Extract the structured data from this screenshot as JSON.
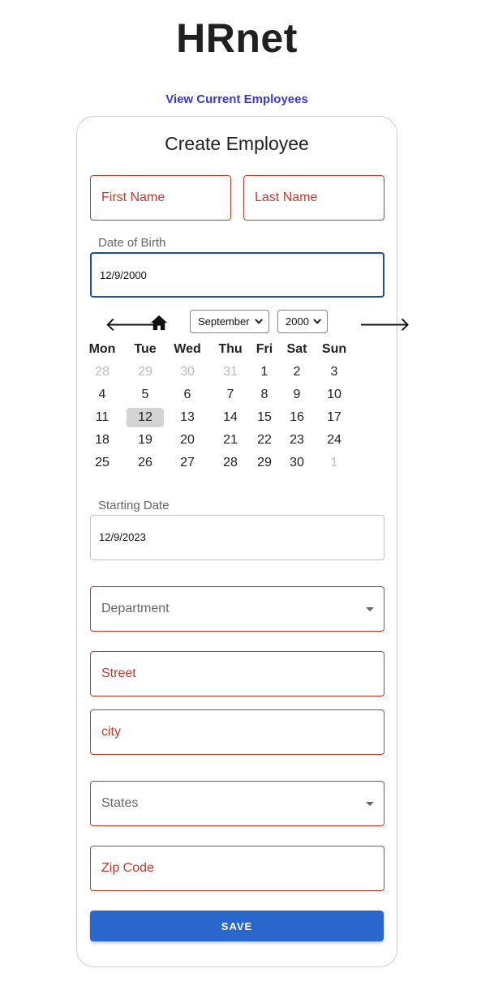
{
  "app": {
    "title": "HRnet"
  },
  "nav": {
    "current_employees_link": "View Current Employees"
  },
  "form": {
    "title": "Create Employee",
    "first_name_placeholder": "First Name",
    "last_name_placeholder": "Last Name",
    "dob_label": "Date of Birth",
    "dob_value": "12/9/2000",
    "start_label": "Starting Date",
    "start_value": "12/9/2023",
    "department_placeholder": "Department",
    "street_placeholder": "Street",
    "city_placeholder": "city",
    "states_placeholder": "States",
    "zip_placeholder": "Zip Code",
    "save_label": "SAVE"
  },
  "calendar": {
    "prev_icon": "arrow-left-icon",
    "home_icon": "home-icon",
    "next_icon": "arrow-right-icon",
    "month": "September",
    "year": "2000",
    "weekdays": [
      "Mon",
      "Tue",
      "Wed",
      "Thu",
      "Fri",
      "Sat",
      "Sun"
    ],
    "weeks": [
      [
        "28",
        "29",
        "30",
        "31",
        "1",
        "2",
        "3"
      ],
      [
        "4",
        "5",
        "6",
        "7",
        "8",
        "9",
        "10"
      ],
      [
        "11",
        "12",
        "13",
        "14",
        "15",
        "16",
        "17"
      ],
      [
        "18",
        "19",
        "20",
        "21",
        "22",
        "23",
        "24"
      ],
      [
        "25",
        "26",
        "27",
        "28",
        "29",
        "30",
        "1"
      ]
    ],
    "selected_day": "12"
  },
  "colors": {
    "accent": "#2a67cc",
    "link": "#3b38d9",
    "error": "#c0392b",
    "focus": "#1f4f9a"
  }
}
